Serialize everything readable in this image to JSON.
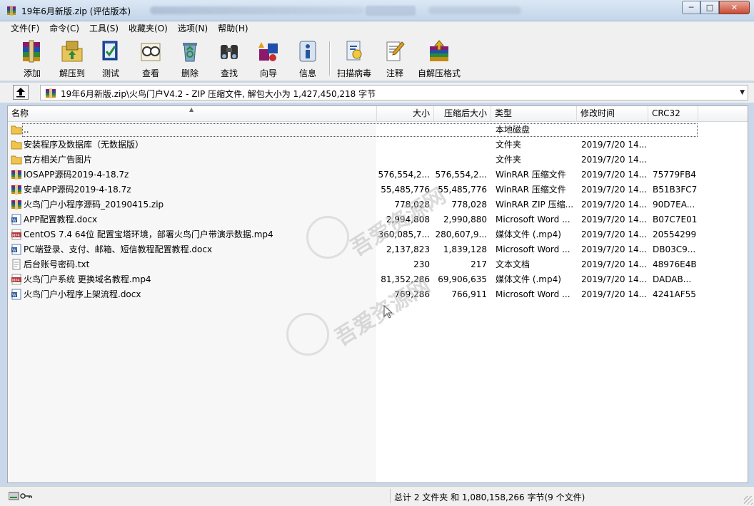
{
  "window": {
    "title": "19年6月新版.zip (评估版本)",
    "controls": {
      "minimize": "─",
      "maximize": "□",
      "close": "✕"
    }
  },
  "menu": [
    "文件(F)",
    "命令(C)",
    "工具(S)",
    "收藏夹(O)",
    "选项(N)",
    "帮助(H)"
  ],
  "toolbar": [
    {
      "label": "添加",
      "icon": "winrar-archive-icon"
    },
    {
      "label": "解压到",
      "icon": "extract-folder-icon"
    },
    {
      "label": "测试",
      "icon": "test-archive-icon"
    },
    {
      "label": "查看",
      "icon": "view-glasses-icon"
    },
    {
      "label": "删除",
      "icon": "delete-recycle-icon"
    },
    {
      "label": "查找",
      "icon": "find-binoculars-icon"
    },
    {
      "label": "向导",
      "icon": "wizard-icon"
    },
    {
      "label": "信息",
      "icon": "info-icon"
    },
    {
      "label": "扫描病毒",
      "icon": "virus-scan-icon"
    },
    {
      "label": "注释",
      "icon": "comment-pencil-icon"
    },
    {
      "label": "自解压格式",
      "icon": "sfx-archive-icon"
    }
  ],
  "address": {
    "path": "19年6月新版.zip\\火鸟门户V4.2 - ZIP 压缩文件, 解包大小为 1,427,450,218 字节"
  },
  "columns": {
    "name": "名称",
    "size": "大小",
    "packed": "压缩后大小",
    "type": "类型",
    "modified": "修改时间",
    "crc": "CRC32"
  },
  "rows": [
    {
      "name": "..",
      "size": "",
      "packed": "",
      "type": "本地磁盘",
      "modified": "",
      "crc": "",
      "icon": "folder-icon"
    },
    {
      "name": "安装程序及数据库（无数据版）",
      "size": "",
      "packed": "",
      "type": "文件夹",
      "modified": "2019/7/20 14...",
      "crc": "",
      "icon": "folder-icon"
    },
    {
      "name": "官方相关广告图片",
      "size": "",
      "packed": "",
      "type": "文件夹",
      "modified": "2019/7/20 14...",
      "crc": "",
      "icon": "folder-icon"
    },
    {
      "name": "IOSAPP源码2019-4-18.7z",
      "size": "576,554,2...",
      "packed": "576,554,2...",
      "type": "WinRAR 压缩文件",
      "modified": "2019/7/20 14...",
      "crc": "75779FB4",
      "icon": "winrar-file-icon"
    },
    {
      "name": "安卓APP源码2019-4-18.7z",
      "size": "55,485,776",
      "packed": "55,485,776",
      "type": "WinRAR 压缩文件",
      "modified": "2019/7/20 14...",
      "crc": "B51B3FC7",
      "icon": "winrar-file-icon"
    },
    {
      "name": "火鸟门户小程序源码_20190415.zip",
      "size": "778,028",
      "packed": "778,028",
      "type": "WinRAR ZIP 压缩...",
      "modified": "2019/7/20 14...",
      "crc": "90D7EA...",
      "icon": "winrar-file-icon"
    },
    {
      "name": "APP配置教程.docx",
      "size": "2,994,808",
      "packed": "2,990,880",
      "type": "Microsoft Word ...",
      "modified": "2019/7/20 14...",
      "crc": "B07C7E01",
      "icon": "word-doc-icon"
    },
    {
      "name": "CentOS 7.4 64位 配置宝塔环境，部署火鸟门户带演示数据.mp4",
      "size": "360,085,7...",
      "packed": "280,607,9...",
      "type": "媒体文件 (.mp4)",
      "modified": "2019/7/20 14...",
      "crc": "20554299",
      "icon": "mp4-video-icon"
    },
    {
      "name": "PC端登录、支付、邮箱、短信教程配置教程.docx",
      "size": "2,137,823",
      "packed": "1,839,128",
      "type": "Microsoft Word ...",
      "modified": "2019/7/20 14...",
      "crc": "DB03C9...",
      "icon": "word-doc-icon"
    },
    {
      "name": "后台账号密码.txt",
      "size": "230",
      "packed": "217",
      "type": "文本文档",
      "modified": "2019/7/20 14...",
      "crc": "48976E4B",
      "icon": "text-file-icon"
    },
    {
      "name": "火鸟门户系统 更换域名教程.mp4",
      "size": "81,352,286",
      "packed": "69,906,635",
      "type": "媒体文件 (.mp4)",
      "modified": "2019/7/20 14...",
      "crc": "DADAB...",
      "icon": "mp4-video-icon"
    },
    {
      "name": "火鸟门户小程序上架流程.docx",
      "size": "769,286",
      "packed": "766,911",
      "type": "Microsoft Word ...",
      "modified": "2019/7/20 14...",
      "crc": "4241AF55",
      "icon": "word-doc-icon"
    }
  ],
  "watermark": {
    "text": "吾爱资源网",
    "subtext": "www.5ooo.cn"
  },
  "status": {
    "text": "总计 2 文件夹 和 1,080,158,266 字节(9 个文件)"
  }
}
